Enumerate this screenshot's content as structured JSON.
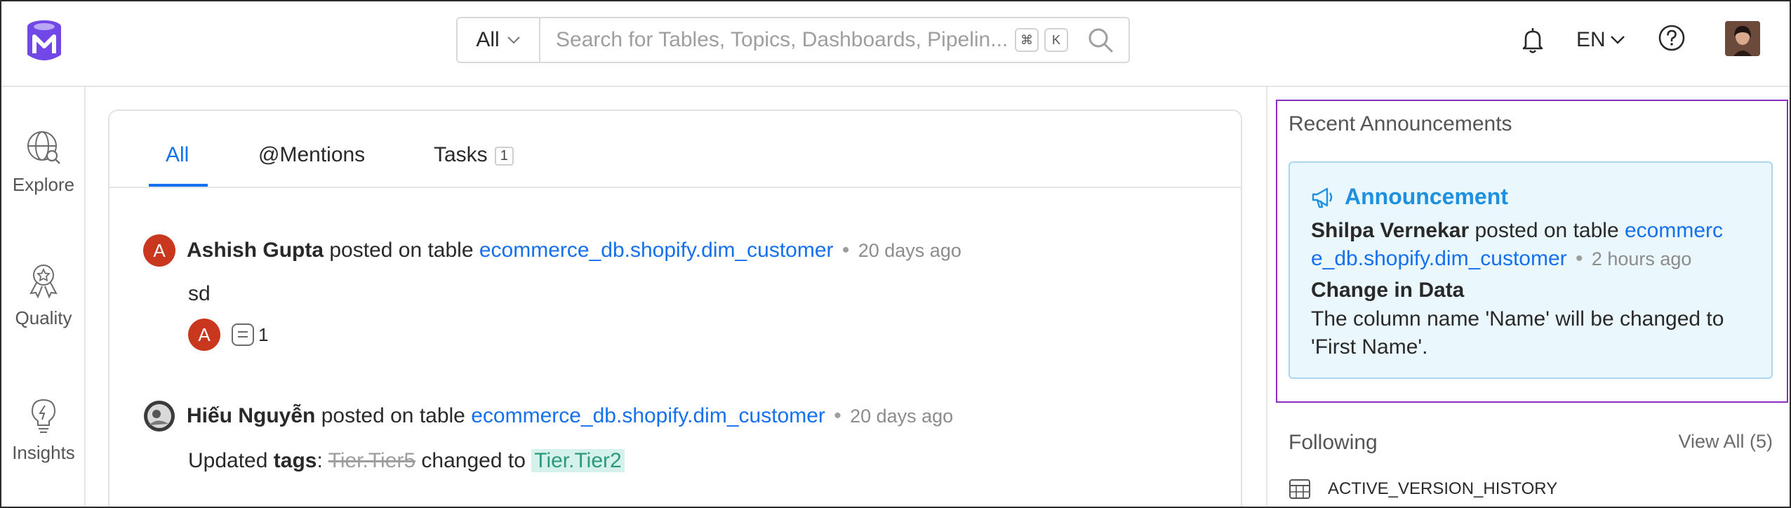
{
  "header": {
    "search_filter": "All",
    "search_placeholder": "Search for Tables, Topics, Dashboards, Pipelin...",
    "kbd_cmd": "⌘",
    "kbd_k": "K",
    "language": "EN"
  },
  "sidebar": {
    "items": [
      {
        "label": "Explore",
        "icon": "explore-globe-icon"
      },
      {
        "label": "Quality",
        "icon": "quality-badge-icon"
      },
      {
        "label": "Insights",
        "icon": "insights-bulb-icon"
      }
    ]
  },
  "feed": {
    "tabs": [
      {
        "label": "All"
      },
      {
        "label": "@Mentions"
      },
      {
        "label": "Tasks",
        "count": "1"
      }
    ],
    "posts": [
      {
        "avatar_letter": "A",
        "author": "Ashish Gupta",
        "action": "posted on table",
        "entity": "ecommerce_db.shopify.dim_customer",
        "separator": "•",
        "time": "20 days ago",
        "message": "sd",
        "reply_avatar": "A",
        "reply_count": "1"
      },
      {
        "author": "Hiếu Nguyễn",
        "action": "posted on table",
        "entity": "ecommerce_db.shopify.dim_customer",
        "separator": "•",
        "time": "20 days ago",
        "prefix": "Updated",
        "field": "tags",
        "colon": ":",
        "old_value": "Tier.Tier5",
        "changed_to": "changed to",
        "new_value": "Tier.Tier2"
      }
    ]
  },
  "announcements": {
    "title": "Recent Announcements",
    "card": {
      "label": "Announcement",
      "author": "Shilpa Vernekar",
      "action": "posted on table",
      "entity_line1": "ecommerc",
      "entity_line2": "e_db.shopify.dim_customer",
      "separator": "•",
      "time": "2 hours ago",
      "subject": "Change in Data",
      "text": "The column name 'Name' will be changed to 'First Name'."
    }
  },
  "following": {
    "title": "Following",
    "view_all": "View All (5)",
    "items": [
      {
        "label": "ACTIVE_VERSION_HISTORY"
      }
    ]
  },
  "colors": {
    "accent": "#1470ef",
    "announcement_border": "#8a2fbf",
    "avatar": "#c8371e"
  }
}
